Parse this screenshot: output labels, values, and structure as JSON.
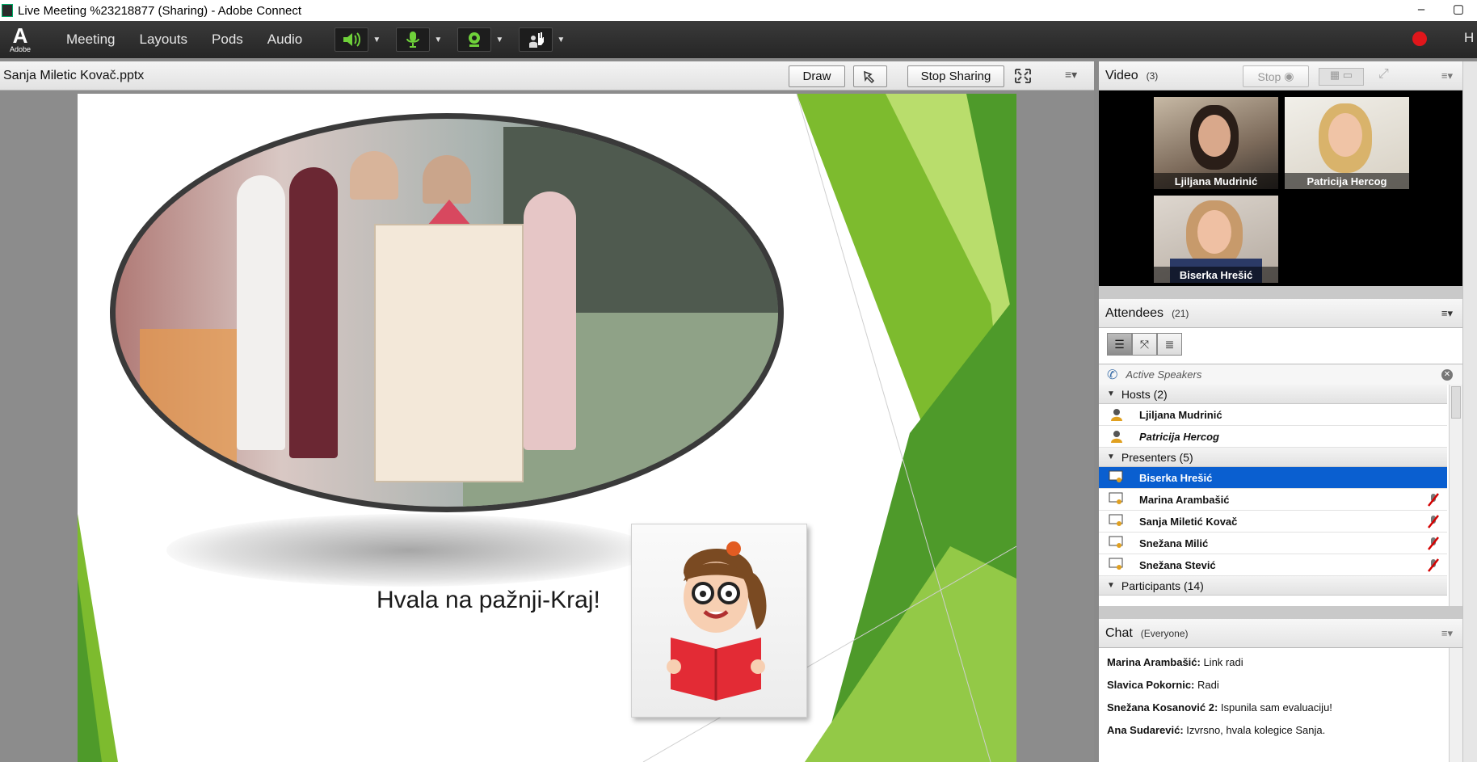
{
  "window": {
    "title": "Live Meeting %23218877 (Sharing) - Adobe Connect",
    "minimize": "–",
    "restore": "▢"
  },
  "menubar": {
    "logo_text": "Adobe",
    "items": [
      "Meeting",
      "Layouts",
      "Pods",
      "Audio"
    ],
    "help_label": "H"
  },
  "share": {
    "file_name": "Sanja Miletic Kovač.pptx",
    "draw_label": "Draw",
    "stop_sharing_label": "Stop Sharing",
    "slide_text": "Hvala na pažnji-Kraj!"
  },
  "video": {
    "title": "Video",
    "count": "(3)",
    "stop_label": "Stop",
    "tiles": [
      {
        "name": "Ljiljana Mudrinić"
      },
      {
        "name": "Patricija Hercog"
      },
      {
        "name": "Biserka Hrešić"
      }
    ]
  },
  "attendees": {
    "title": "Attendees",
    "count": "(21)",
    "active_speakers": "Active Speakers",
    "groups": {
      "hosts": "Hosts (2)",
      "presenters": "Presenters (5)",
      "participants": "Participants (14)"
    },
    "hosts": [
      "Ljiljana Mudrinić",
      "Patricija Hercog"
    ],
    "presenters": [
      "Biserka Hrešić",
      "Marina Arambašić",
      "Sanja Miletić Kovač",
      "Snežana Milić",
      "Snežana Stević"
    ],
    "selected": "Biserka Hrešić"
  },
  "chat": {
    "title": "Chat",
    "scope": "(Everyone)",
    "messages": [
      {
        "sender": "Marina Arambašić:",
        "text": " Link radi"
      },
      {
        "sender": "Slavica Pokornic:",
        "text": " Radi"
      },
      {
        "sender": "Snežana Kosanović 2:",
        "text": " Ispunila sam evaluaciju!"
      },
      {
        "sender": "Ana Sudarević:",
        "text": " Izvrsno, hvala kolegice Sanja."
      }
    ]
  },
  "colors": {
    "selection": "#0a5fd0",
    "record": "#e0161b",
    "speaker_active": "#6fd13a",
    "slide_green": "#7dbb2e"
  }
}
